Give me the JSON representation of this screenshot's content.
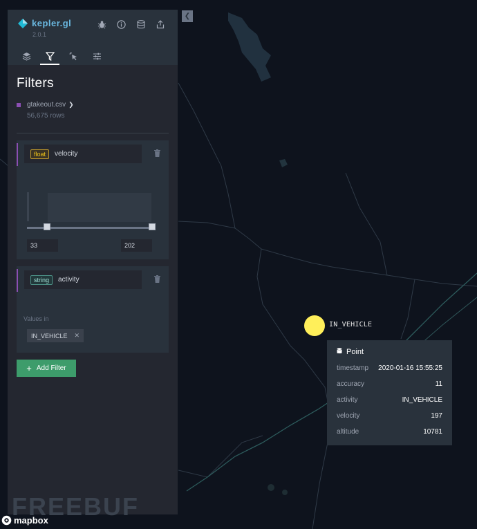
{
  "app": {
    "name": "kepler.gl",
    "version": "2.0.1"
  },
  "header_icons": [
    "bug-icon",
    "info-icon",
    "database-icon",
    "share-icon"
  ],
  "tabs": [
    {
      "name": "layers-icon",
      "active": false
    },
    {
      "name": "filter-icon",
      "active": true
    },
    {
      "name": "interaction-icon",
      "active": false
    },
    {
      "name": "settings-icon",
      "active": false
    }
  ],
  "panel": {
    "title": "Filters",
    "dataset": {
      "name": "gtakeout.csv",
      "rows": "56,675 rows",
      "color": "#8b4fb3"
    }
  },
  "filters": [
    {
      "type": "float",
      "field": "velocity",
      "min": "33",
      "max": "202"
    },
    {
      "type": "string",
      "field": "activity",
      "values_label": "Values in",
      "value": "IN_VEHICLE"
    }
  ],
  "add_filter_label": "Add Filter",
  "map": {
    "point_label": "IN_VEHICLE",
    "point_color": "#ffef5a"
  },
  "tooltip": {
    "title": "Point",
    "rows": [
      {
        "key": "timestamp",
        "value": "2020-01-16 15:55:25"
      },
      {
        "key": "accuracy",
        "value": "11"
      },
      {
        "key": "activity",
        "value": "IN_VEHICLE"
      },
      {
        "key": "velocity",
        "value": "197"
      },
      {
        "key": "altitude",
        "value": "10781"
      }
    ]
  },
  "watermark": "FREEBUF",
  "attribution": "mapbox"
}
